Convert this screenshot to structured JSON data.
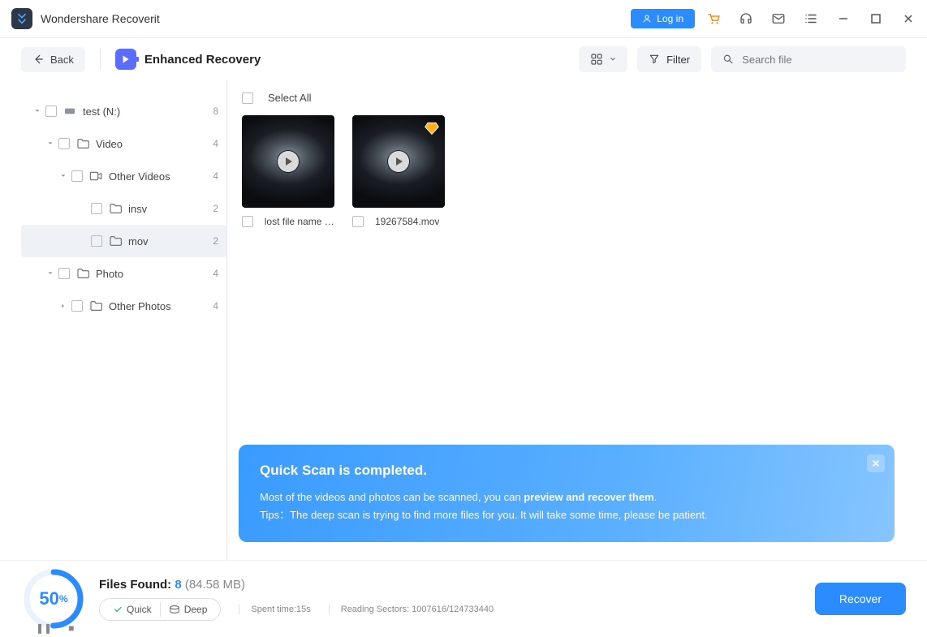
{
  "app": {
    "title": "Wondershare Recoverit",
    "login": "Log in"
  },
  "toolbar": {
    "back": "Back",
    "mode": "Enhanced Recovery",
    "filter": "Filter",
    "search_placeholder": "Search file"
  },
  "tree": [
    {
      "label": "test (N:)",
      "count": "8",
      "icon": "drive",
      "indent": 0,
      "caret": "down"
    },
    {
      "label": "Video",
      "count": "4",
      "icon": "folder",
      "indent": 1,
      "caret": "down"
    },
    {
      "label": "Other Videos",
      "count": "4",
      "icon": "video",
      "indent": 2,
      "caret": "down"
    },
    {
      "label": "insv",
      "count": "2",
      "icon": "folder",
      "indent": 3,
      "caret": "none"
    },
    {
      "label": "mov",
      "count": "2",
      "icon": "folder",
      "indent": 3,
      "caret": "none",
      "selected": true
    },
    {
      "label": "Photo",
      "count": "4",
      "icon": "folder",
      "indent": 1,
      "caret": "down"
    },
    {
      "label": "Other Photos",
      "count": "4",
      "icon": "folder",
      "indent": 2,
      "caret": "right"
    }
  ],
  "content": {
    "select_all": "Select All",
    "files": [
      {
        "name": "lost file name (...",
        "premium": false
      },
      {
        "name": "19267584.mov",
        "premium": true
      }
    ]
  },
  "banner": {
    "title": "Quick Scan is completed.",
    "line1_a": "Most of the videos and photos can be scanned, you can ",
    "line1_b": "preview and recover them",
    "line1_c": ".",
    "line2": "Tips：The deep scan is trying to find more files for you. It will take some time, please be patient."
  },
  "footer": {
    "progress": "50",
    "files_found_label": "Files Found: ",
    "files_found_count": "8",
    "files_found_size": " (84.58 MB)",
    "quick": "Quick",
    "deep": "Deep",
    "spent": "Spent time:15s",
    "sectors": "Reading Sectors: 1007616/124733440",
    "recover": "Recover"
  }
}
